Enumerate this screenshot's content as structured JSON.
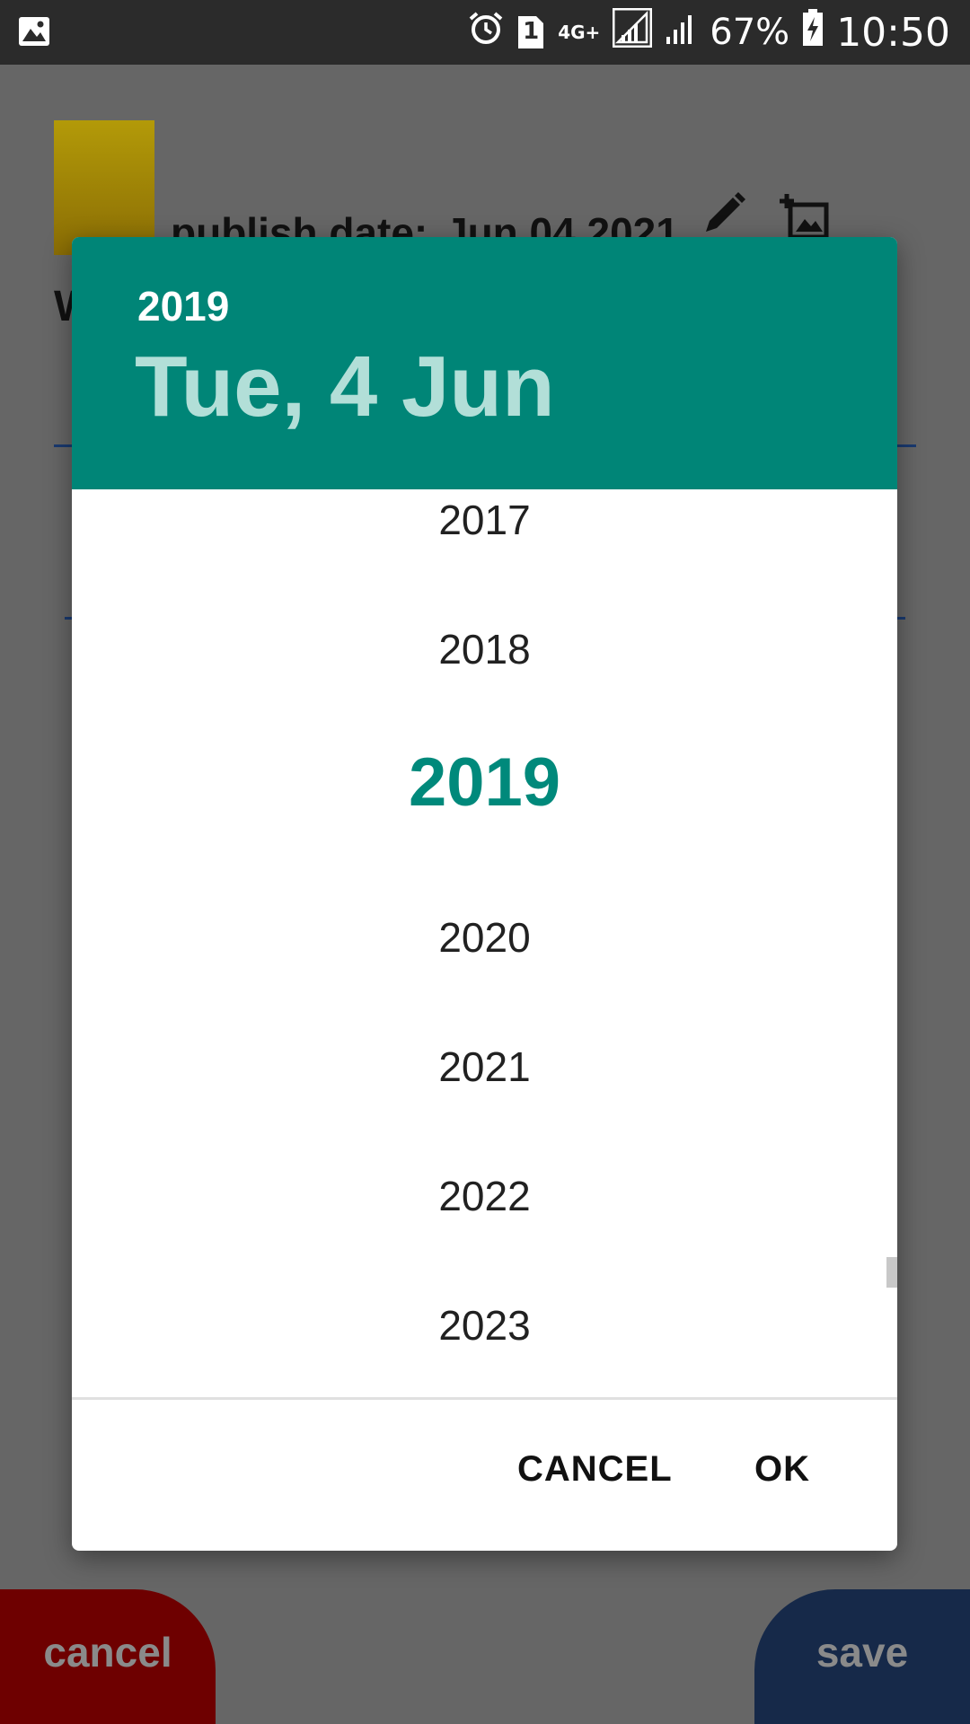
{
  "status_bar": {
    "battery": "67%",
    "time": "10:50",
    "network": "4G+",
    "sim_badge": "1",
    "icons": [
      "image-notification-icon",
      "alarm-icon",
      "sim-icon",
      "signal-icon",
      "signal-icon-2",
      "battery-charging-icon"
    ]
  },
  "background": {
    "publish_label": "publish date:",
    "publish_value": "Jun 04 2021",
    "cancel_label": "cancel",
    "save_label": "save",
    "partial_heading": "W"
  },
  "dialog": {
    "header_year": "2019",
    "header_date": "Tue, 4 Jun",
    "years": [
      "2017",
      "2018",
      "2019",
      "2020",
      "2021",
      "2022",
      "2023"
    ],
    "selected_year": "2019",
    "cancel_label": "CANCEL",
    "ok_label": "OK"
  },
  "colors": {
    "accent": "#008577",
    "selected_year": "#00897b",
    "header_date": "#b2dfd8",
    "cancel_bg": "#6e0000",
    "save_bg": "#162949"
  }
}
